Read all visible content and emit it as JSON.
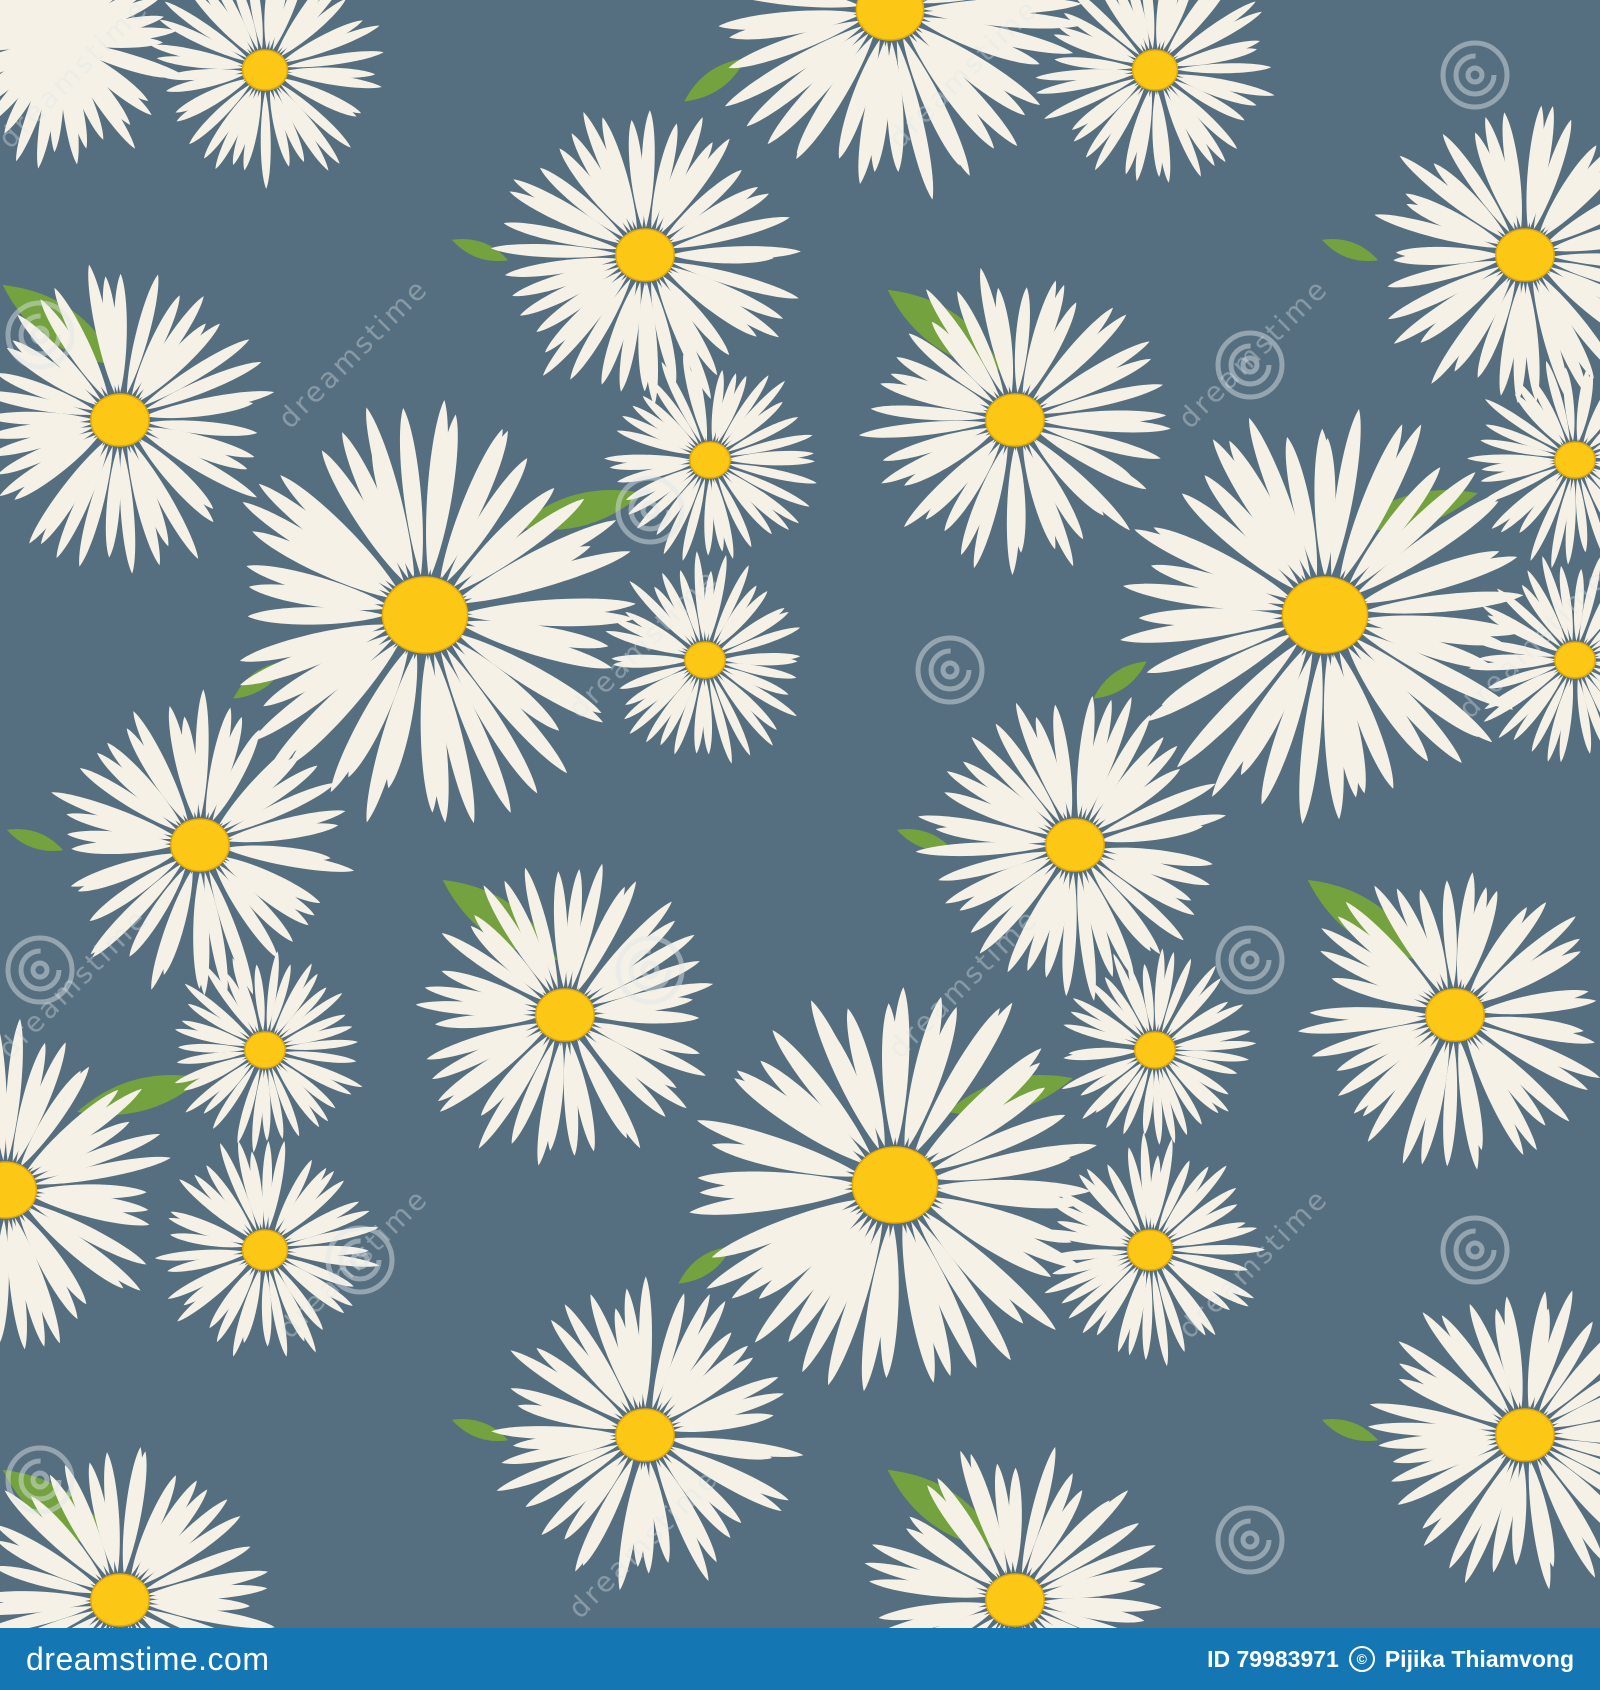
{
  "image": {
    "background_color": "#566f80",
    "petal_color": "#f5f1e6",
    "center_color": "#fdc715",
    "leaf_color": "#73a23e",
    "watermark_text": "dreamstime"
  },
  "footer": {
    "background_color": "#1477b3",
    "logo_text": "dreamstime.com",
    "id_text": "ID 79983971",
    "author_text": "Pijika Thiamvong"
  }
}
